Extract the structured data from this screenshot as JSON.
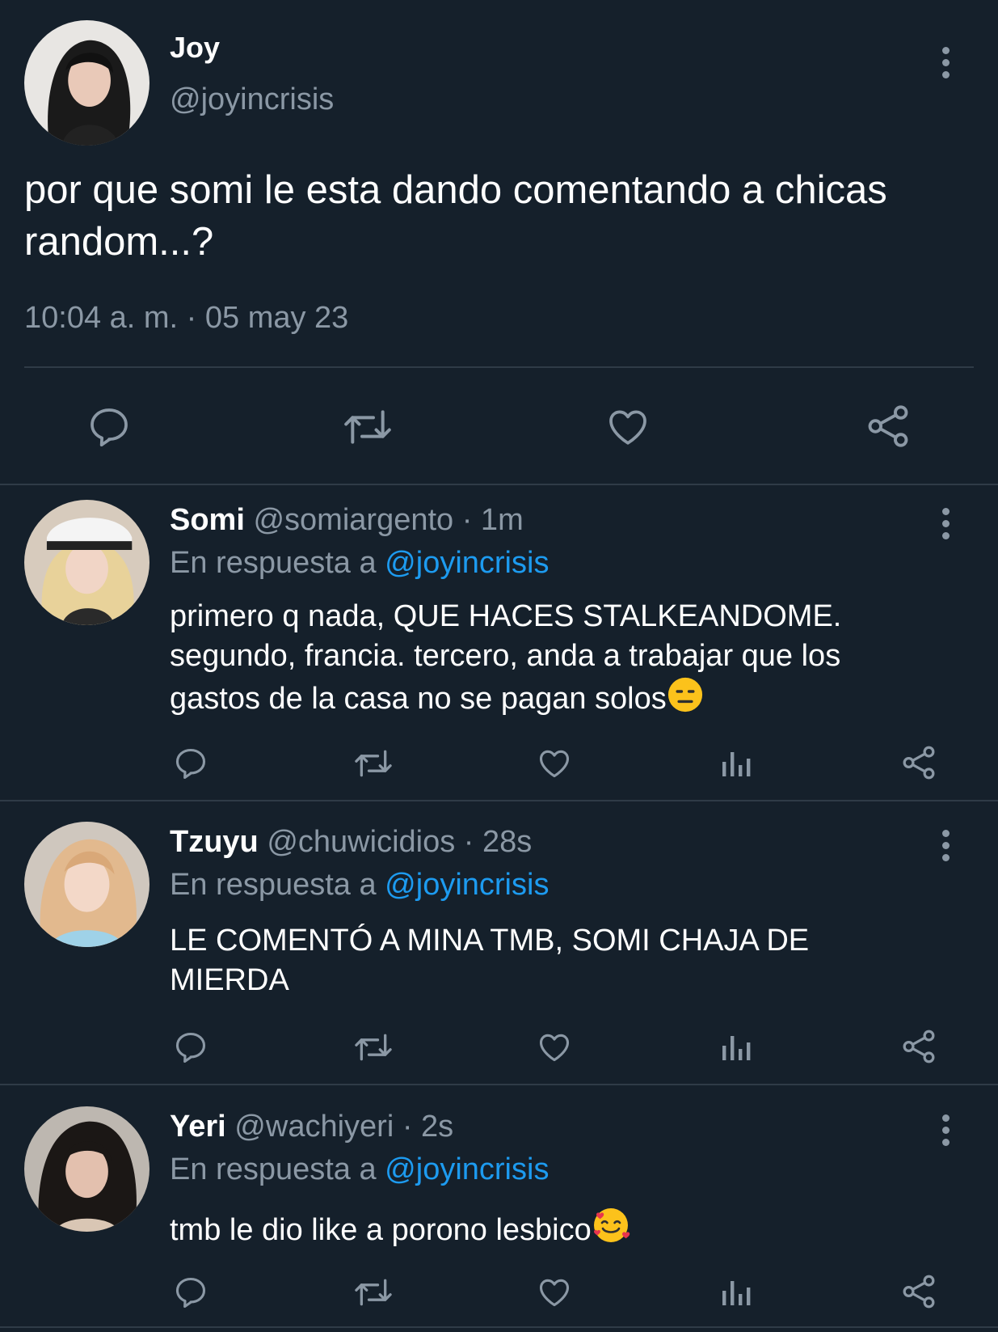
{
  "main_tweet": {
    "name": "Joy",
    "handle": "@joyincrisis",
    "text_line1": "por que somi le esta dando comentando a chicas",
    "text_line2": "random...?",
    "timestamp": "10:04 a. m. · 05 may 23"
  },
  "replies": [
    {
      "name": "Somi",
      "handle": "@somiargento",
      "time": "· 1m",
      "reply_prefix": "En respuesta a",
      "reply_to": "@joyincrisis",
      "line1": "primero q nada, QUE HACES STALKEANDOME.",
      "line2": "segundo, francia. tercero, anda a trabajar que los",
      "line3": "gastos de la casa no se pagan solos",
      "emoji": "expressionless-face"
    },
    {
      "name": "Tzuyu",
      "handle": "@chuwicidios",
      "time": "· 28s",
      "reply_prefix": "En respuesta a",
      "reply_to": "@joyincrisis",
      "line1": "LE COMENTÓ A MINA TMB, SOMI CHAJA DE",
      "line2": "MIERDA"
    },
    {
      "name": "Yeri",
      "handle": "@wachiyeri",
      "time": "· 2s",
      "reply_prefix": "En respuesta a",
      "reply_to": "@joyincrisis",
      "line1": "tmb le dio like a porono lesbico",
      "emoji": "smiling-face-with-hearts"
    }
  ],
  "icons": [
    "reply-icon",
    "retweet-icon",
    "like-icon",
    "views-icon",
    "share-icon",
    "more-icon"
  ],
  "colors": {
    "background": "#15202b",
    "text": "#e7e9ea",
    "muted": "#8b98a5",
    "link": "#1d9bf0",
    "divider": "#2f3b47"
  }
}
